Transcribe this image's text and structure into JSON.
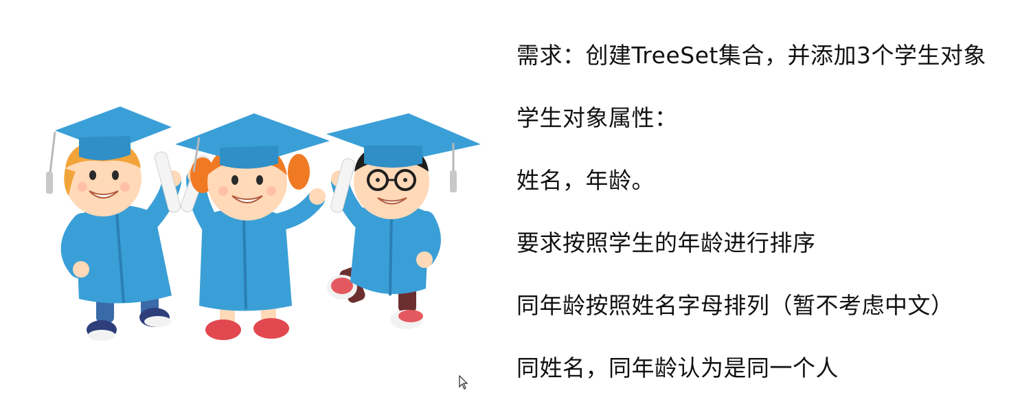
{
  "slide": {
    "lines": [
      "需求：创建TreeSet集合，并添加3个学生对象",
      "学生对象属性：",
      "姓名，年龄。",
      "要求按照学生的年龄进行排序",
      "同年龄按照姓名字母排列（暂不考虑中文）",
      "同姓名，同年龄认为是同一个人"
    ]
  },
  "colors": {
    "gown": "#3a9fd6",
    "gown_dark": "#2a7fb4",
    "skin": "#ffd9b8",
    "hair_boy": "#f2a43a",
    "hair_girl": "#f07a24",
    "hair_glasses": "#1e1e1e",
    "shoe_red": "#e2484f",
    "text": "#111111"
  },
  "icons": {
    "illustration": "graduates-illustration",
    "cursor": "mouse-pointer-icon"
  }
}
